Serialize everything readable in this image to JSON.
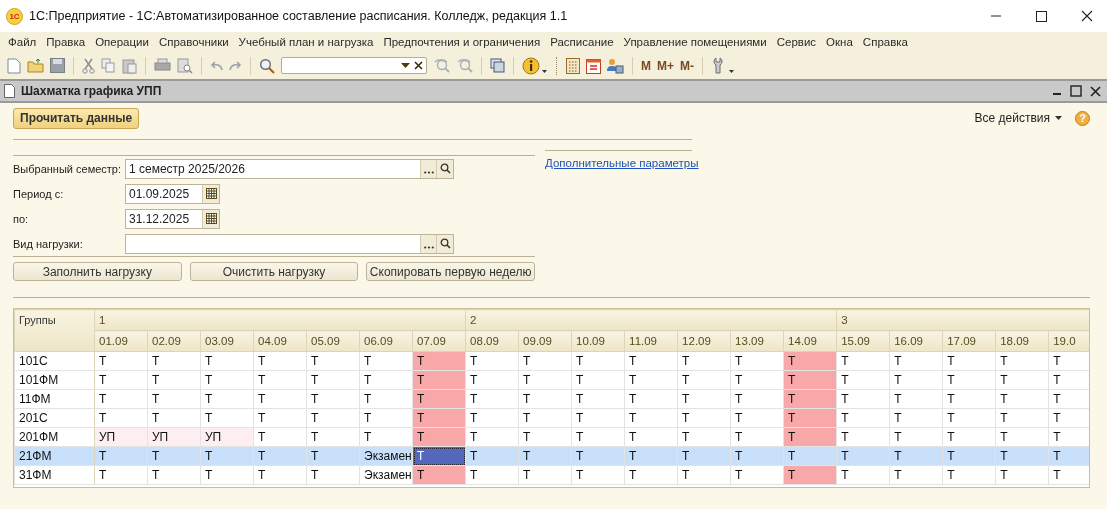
{
  "window": {
    "logo": "1С",
    "title": "1С:Предприятие - 1С:Автоматизированное составление расписания. Колледж, редакция 1.1"
  },
  "menu": [
    "Файл",
    "Правка",
    "Операции",
    "Справочники",
    "Учебный план и нагрузка",
    "Предпочтения и ограничения",
    "Расписание",
    "Управление помещениями",
    "Сервис",
    "Окна",
    "Справка"
  ],
  "toolbar": {
    "memory_buttons": [
      "M",
      "M+",
      "M-"
    ]
  },
  "form": {
    "title": "Шахматка графика УПП",
    "read_button": "Прочитать данные",
    "all_actions": "Все действия",
    "help": "?",
    "link": "Дополнительные параметры",
    "fields": [
      {
        "label": "Выбранный семестр:",
        "value": "1 семестр 2025/2026",
        "kind": "reference"
      },
      {
        "label": "Период с:",
        "value": "01.09.2025",
        "kind": "date"
      },
      {
        "label": "по:",
        "value": "31.12.2025",
        "kind": "date"
      },
      {
        "label": "Вид нагрузки:",
        "kind": "reference"
      }
    ],
    "buttons": [
      "Заполнить нагрузку",
      "Очистить нагрузку",
      "Скопировать первую неделю"
    ]
  },
  "table": {
    "group_header": "Группы",
    "weeks": [
      {
        "label": "1",
        "days": [
          "01.09",
          "02.09",
          "03.09",
          "04.09",
          "05.09",
          "06.09",
          "07.09"
        ]
      },
      {
        "label": "2",
        "days": [
          "08.09",
          "09.09",
          "10.09",
          "11.09",
          "12.09",
          "13.09",
          "14.09"
        ]
      },
      {
        "label": "3",
        "days": [
          "15.09",
          "16.09",
          "17.09",
          "18.09",
          "19.0"
        ]
      }
    ],
    "rows": [
      {
        "group": "101С",
        "selected": false,
        "cells": [
          {
            "text": "Т",
            "kind": "day"
          },
          {
            "text": "Т",
            "kind": "day"
          },
          {
            "text": "Т",
            "kind": "day"
          },
          {
            "text": "Т",
            "kind": "day"
          },
          {
            "text": "Т",
            "kind": "day"
          },
          {
            "text": "Т",
            "kind": "day"
          },
          {
            "text": "Т",
            "kind": "weekend"
          },
          {
            "text": "Т",
            "kind": "day"
          },
          {
            "text": "Т",
            "kind": "day"
          },
          {
            "text": "Т",
            "kind": "day"
          },
          {
            "text": "Т",
            "kind": "day"
          },
          {
            "text": "Т",
            "kind": "day"
          },
          {
            "text": "Т",
            "kind": "day"
          },
          {
            "text": "Т",
            "kind": "weekend"
          },
          {
            "text": "Т",
            "kind": "day"
          },
          {
            "text": "Т",
            "kind": "day"
          },
          {
            "text": "Т",
            "kind": "day"
          },
          {
            "text": "Т",
            "kind": "day"
          },
          {
            "text": "Т",
            "kind": "day"
          }
        ]
      },
      {
        "group": "101ФМ",
        "selected": false,
        "cells": [
          {
            "text": "Т",
            "kind": "day"
          },
          {
            "text": "Т",
            "kind": "day"
          },
          {
            "text": "Т",
            "kind": "day"
          },
          {
            "text": "Т",
            "kind": "day"
          },
          {
            "text": "Т",
            "kind": "day"
          },
          {
            "text": "Т",
            "kind": "day"
          },
          {
            "text": "Т",
            "kind": "weekend"
          },
          {
            "text": "Т",
            "kind": "day"
          },
          {
            "text": "Т",
            "kind": "day"
          },
          {
            "text": "Т",
            "kind": "day"
          },
          {
            "text": "Т",
            "kind": "day"
          },
          {
            "text": "Т",
            "kind": "day"
          },
          {
            "text": "Т",
            "kind": "day"
          },
          {
            "text": "Т",
            "kind": "weekend"
          },
          {
            "text": "Т",
            "kind": "day"
          },
          {
            "text": "Т",
            "kind": "day"
          },
          {
            "text": "Т",
            "kind": "day"
          },
          {
            "text": "Т",
            "kind": "day"
          },
          {
            "text": "Т",
            "kind": "day"
          }
        ]
      },
      {
        "group": "11ФМ",
        "selected": false,
        "cells": [
          {
            "text": "Т",
            "kind": "day"
          },
          {
            "text": "Т",
            "kind": "day"
          },
          {
            "text": "Т",
            "kind": "day"
          },
          {
            "text": "Т",
            "kind": "day"
          },
          {
            "text": "Т",
            "kind": "day"
          },
          {
            "text": "Т",
            "kind": "day"
          },
          {
            "text": "Т",
            "kind": "weekend"
          },
          {
            "text": "Т",
            "kind": "day"
          },
          {
            "text": "Т",
            "kind": "day"
          },
          {
            "text": "Т",
            "kind": "day"
          },
          {
            "text": "Т",
            "kind": "day"
          },
          {
            "text": "Т",
            "kind": "day"
          },
          {
            "text": "Т",
            "kind": "day"
          },
          {
            "text": "Т",
            "kind": "weekend"
          },
          {
            "text": "Т",
            "kind": "day"
          },
          {
            "text": "Т",
            "kind": "day"
          },
          {
            "text": "Т",
            "kind": "day"
          },
          {
            "text": "Т",
            "kind": "day"
          },
          {
            "text": "Т",
            "kind": "day"
          }
        ]
      },
      {
        "group": "201С",
        "selected": false,
        "cells": [
          {
            "text": "Т",
            "kind": "day"
          },
          {
            "text": "Т",
            "kind": "day"
          },
          {
            "text": "Т",
            "kind": "day"
          },
          {
            "text": "Т",
            "kind": "day"
          },
          {
            "text": "Т",
            "kind": "day"
          },
          {
            "text": "Т",
            "kind": "day"
          },
          {
            "text": "Т",
            "kind": "weekend"
          },
          {
            "text": "Т",
            "kind": "day"
          },
          {
            "text": "Т",
            "kind": "day"
          },
          {
            "text": "Т",
            "kind": "day"
          },
          {
            "text": "Т",
            "kind": "day"
          },
          {
            "text": "Т",
            "kind": "day"
          },
          {
            "text": "Т",
            "kind": "day"
          },
          {
            "text": "Т",
            "kind": "weekend"
          },
          {
            "text": "Т",
            "kind": "day"
          },
          {
            "text": "Т",
            "kind": "day"
          },
          {
            "text": "Т",
            "kind": "day"
          },
          {
            "text": "Т",
            "kind": "day"
          },
          {
            "text": "Т",
            "kind": "day"
          }
        ]
      },
      {
        "group": "201ФМ",
        "selected": false,
        "cells": [
          {
            "text": "УП",
            "kind": "practice"
          },
          {
            "text": "УП",
            "kind": "practice"
          },
          {
            "text": "УП",
            "kind": "practice"
          },
          {
            "text": "Т",
            "kind": "day"
          },
          {
            "text": "Т",
            "kind": "day"
          },
          {
            "text": "Т",
            "kind": "day"
          },
          {
            "text": "Т",
            "kind": "weekend"
          },
          {
            "text": "Т",
            "kind": "day"
          },
          {
            "text": "Т",
            "kind": "day"
          },
          {
            "text": "Т",
            "kind": "day"
          },
          {
            "text": "Т",
            "kind": "day"
          },
          {
            "text": "Т",
            "kind": "day"
          },
          {
            "text": "Т",
            "kind": "day"
          },
          {
            "text": "Т",
            "kind": "weekend"
          },
          {
            "text": "Т",
            "kind": "day"
          },
          {
            "text": "Т",
            "kind": "day"
          },
          {
            "text": "Т",
            "kind": "day"
          },
          {
            "text": "Т",
            "kind": "day"
          },
          {
            "text": "Т",
            "kind": "day"
          }
        ]
      },
      {
        "group": "21ФМ",
        "selected": true,
        "cells": [
          {
            "text": "Т",
            "kind": "day"
          },
          {
            "text": "Т",
            "kind": "day"
          },
          {
            "text": "Т",
            "kind": "day"
          },
          {
            "text": "Т",
            "kind": "day"
          },
          {
            "text": "Т",
            "kind": "day"
          },
          {
            "text": "Экзамен",
            "kind": "day"
          },
          {
            "text": "Т",
            "kind": "current"
          },
          {
            "text": "Т",
            "kind": "day"
          },
          {
            "text": "Т",
            "kind": "day"
          },
          {
            "text": "Т",
            "kind": "day"
          },
          {
            "text": "Т",
            "kind": "day"
          },
          {
            "text": "Т",
            "kind": "day"
          },
          {
            "text": "Т",
            "kind": "day"
          },
          {
            "text": "Т",
            "kind": "day"
          },
          {
            "text": "Т",
            "kind": "day"
          },
          {
            "text": "Т",
            "kind": "day"
          },
          {
            "text": "Т",
            "kind": "day"
          },
          {
            "text": "Т",
            "kind": "day"
          },
          {
            "text": "Т",
            "kind": "day"
          }
        ]
      },
      {
        "group": "31ФМ",
        "selected": false,
        "cells": [
          {
            "text": "Т",
            "kind": "day"
          },
          {
            "text": "Т",
            "kind": "day"
          },
          {
            "text": "Т",
            "kind": "day"
          },
          {
            "text": "Т",
            "kind": "day"
          },
          {
            "text": "Т",
            "kind": "day"
          },
          {
            "text": "Экзамен",
            "kind": "day"
          },
          {
            "text": "Т",
            "kind": "weekend"
          },
          {
            "text": "Т",
            "kind": "day"
          },
          {
            "text": "Т",
            "kind": "day"
          },
          {
            "text": "Т",
            "kind": "day"
          },
          {
            "text": "Т",
            "kind": "day"
          },
          {
            "text": "Т",
            "kind": "day"
          },
          {
            "text": "Т",
            "kind": "day"
          },
          {
            "text": "Т",
            "kind": "weekend"
          },
          {
            "text": "Т",
            "kind": "day"
          },
          {
            "text": "Т",
            "kind": "day"
          },
          {
            "text": "Т",
            "kind": "day"
          },
          {
            "text": "Т",
            "kind": "day"
          },
          {
            "text": "Т",
            "kind": "day"
          }
        ]
      }
    ]
  }
}
